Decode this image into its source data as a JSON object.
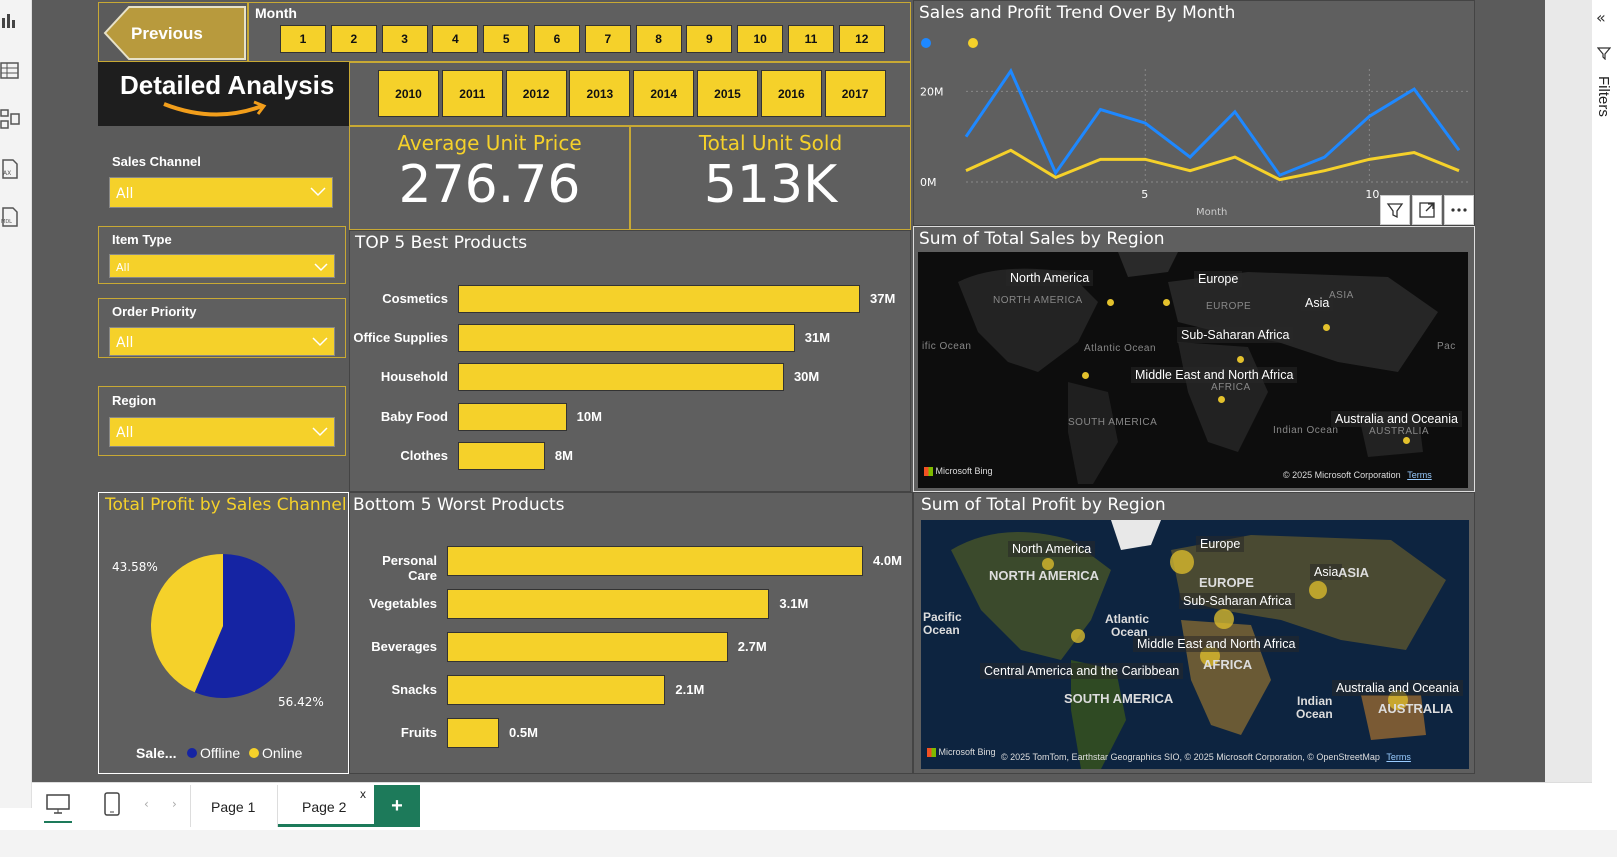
{
  "nav": {
    "previous_label": "Previous",
    "month_label": "Month"
  },
  "months": [
    "1",
    "2",
    "3",
    "4",
    "5",
    "6",
    "7",
    "8",
    "9",
    "10",
    "11",
    "12"
  ],
  "years": [
    "2010",
    "2011",
    "2012",
    "2013",
    "2014",
    "2015",
    "2016",
    "2017"
  ],
  "brand": {
    "title": "Detailed Analysis"
  },
  "kpis": {
    "avg_price_label": "Average Unit Price",
    "avg_price_value": "276.76",
    "units_label": "Total Unit Sold",
    "units_value": "513K"
  },
  "slicers": {
    "sales_channel": {
      "label": "Sales Channel",
      "value": "All"
    },
    "item_type": {
      "label": "Item Type",
      "value": "All"
    },
    "order_priority": {
      "label": "Order Priority",
      "value": "All"
    },
    "region": {
      "label": "Region",
      "value": "All"
    }
  },
  "top5": {
    "title": "TOP 5 Best Products",
    "items": [
      {
        "label": "Cosmetics",
        "value": 37,
        "text": "37M"
      },
      {
        "label": "Office Supplies",
        "value": 31,
        "text": "31M"
      },
      {
        "label": "Household",
        "value": 30,
        "text": "30M"
      },
      {
        "label": "Baby Food",
        "value": 10,
        "text": "10M"
      },
      {
        "label": "Clothes",
        "value": 8,
        "text": "8M"
      }
    ]
  },
  "bottom5": {
    "title": "Bottom 5 Worst Products",
    "items": [
      {
        "label": "Personal Care",
        "value": 4.0,
        "text": "4.0M"
      },
      {
        "label": "Vegetables",
        "value": 3.1,
        "text": "3.1M"
      },
      {
        "label": "Beverages",
        "value": 2.7,
        "text": "2.7M"
      },
      {
        "label": "Snacks",
        "value": 2.1,
        "text": "2.1M"
      },
      {
        "label": "Fruits",
        "value": 0.5,
        "text": "0.5M"
      }
    ]
  },
  "pie": {
    "title": "Total Profit by Sales Channel",
    "legend_title": "Sale...",
    "legend": [
      "Offline",
      "Online"
    ],
    "colors": [
      "#1524a3",
      "#f5d12a"
    ],
    "labels": [
      "56.42%",
      "43.58%"
    ]
  },
  "trend": {
    "title": "Sales and Profit Trend Over By Month",
    "xlabel": "Month",
    "colors": [
      "#1e88ff",
      "#f5d12a"
    ],
    "yticks": [
      "20M",
      "0M"
    ],
    "xticks": [
      "5",
      "10"
    ]
  },
  "chart_data": [
    {
      "type": "bar",
      "title": "TOP 5 Best Products",
      "categories": [
        "Cosmetics",
        "Office Supplies",
        "Household",
        "Baby Food",
        "Clothes"
      ],
      "values": [
        37,
        31,
        30,
        10,
        8
      ]
    },
    {
      "type": "bar",
      "title": "Bottom 5 Worst Products",
      "categories": [
        "Personal Care",
        "Vegetables",
        "Beverages",
        "Snacks",
        "Fruits"
      ],
      "values": [
        4.0,
        3.1,
        2.7,
        2.1,
        0.5
      ]
    },
    {
      "type": "pie",
      "title": "Total Profit by Sales Channel",
      "categories": [
        "Offline",
        "Online"
      ],
      "values": [
        56.42,
        43.58
      ]
    },
    {
      "type": "line",
      "title": "Sales and Profit Trend Over By Month",
      "xlabel": "Month",
      "x": [
        1,
        2,
        3,
        4,
        5,
        6,
        7,
        8,
        9,
        10,
        11,
        12
      ],
      "ylim": [
        0,
        26
      ],
      "series": [
        {
          "values": [
            10,
            24.5,
            2,
            16,
            13,
            5.5,
            15.5,
            1.5,
            5.5,
            14.5,
            20.5,
            7
          ]
        },
        {
          "values": [
            2.5,
            7,
            1,
            5,
            5,
            2.5,
            5.5,
            0.5,
            2.5,
            5,
            6.5,
            2.5
          ]
        }
      ]
    }
  ],
  "region_sales": {
    "title": "Sum of Total Sales by Region",
    "labels": [
      "North America",
      "Europe",
      "Asia",
      "Sub-Saharan Africa",
      "Middle East and North Africa",
      "Australia and Oceania"
    ],
    "faint": [
      "NORTH AMERICA",
      "EUROPE",
      "ASIA",
      "Atlantic Ocean",
      "ific Ocean",
      "AFRICA",
      "SOUTH AMERICA",
      "Indian Ocean",
      "AUSTRALIA",
      "Pac"
    ],
    "bing": "Microsoft Bing",
    "copyright": "© 2025 Microsoft Corporation",
    "terms": "Terms"
  },
  "region_profit": {
    "title": "Sum of Total Profit by Region",
    "labels": [
      "North America",
      "Europe",
      "Asia",
      "Sub-Saharan Africa",
      "Middle East and North Africa",
      "Central America and the Caribbean",
      "Australia and Oceania"
    ],
    "bold": [
      "NORTH AMERICA",
      "EUROPE",
      "ASIA",
      "AFRICA",
      "SOUTH AMERICA",
      "AUSTRALIA",
      "Pacific",
      "Ocean",
      "Atlantic",
      "Ocean",
      "Indian",
      "Ocean"
    ],
    "bing": "Microsoft Bing",
    "copyright": "© 2025 TomTom, Earthstar Geographics SIO, © 2025 Microsoft Corporation, © OpenStreetMap",
    "terms": "Terms"
  },
  "tabs": {
    "page1": "Page 1",
    "page2": "Page 2",
    "close": "x",
    "add": "+"
  },
  "filters_label": "Filters"
}
